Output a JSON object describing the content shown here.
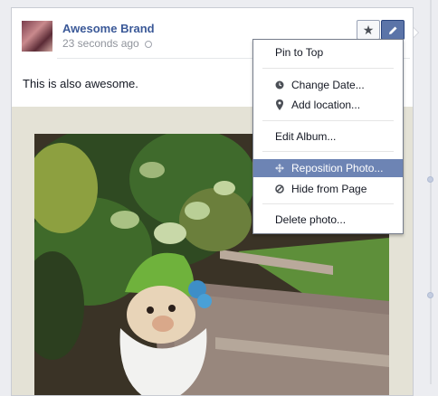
{
  "post": {
    "author": "Awesome Brand",
    "timestamp": "23 seconds ago",
    "text": "This is also awesome."
  },
  "header_buttons": {
    "star_icon": "star-icon",
    "edit_icon": "pencil-icon"
  },
  "menu": {
    "items": [
      {
        "label": "Pin to Top",
        "icon": null
      },
      {
        "label": "Change Date...",
        "icon": "clock-icon"
      },
      {
        "label": "Add location...",
        "icon": "location-pin-icon"
      },
      {
        "label": "Edit Album...",
        "icon": null
      },
      {
        "label": "Reposition Photo...",
        "icon": "move-arrows-icon",
        "highlighted": true
      },
      {
        "label": "Hide from Page",
        "icon": "block-icon"
      },
      {
        "label": "Delete photo...",
        "icon": null
      }
    ]
  },
  "colors": {
    "brand_blue": "#3b5998",
    "menu_highlight": "#6d84b4",
    "edit_button": "#5b74a8"
  }
}
